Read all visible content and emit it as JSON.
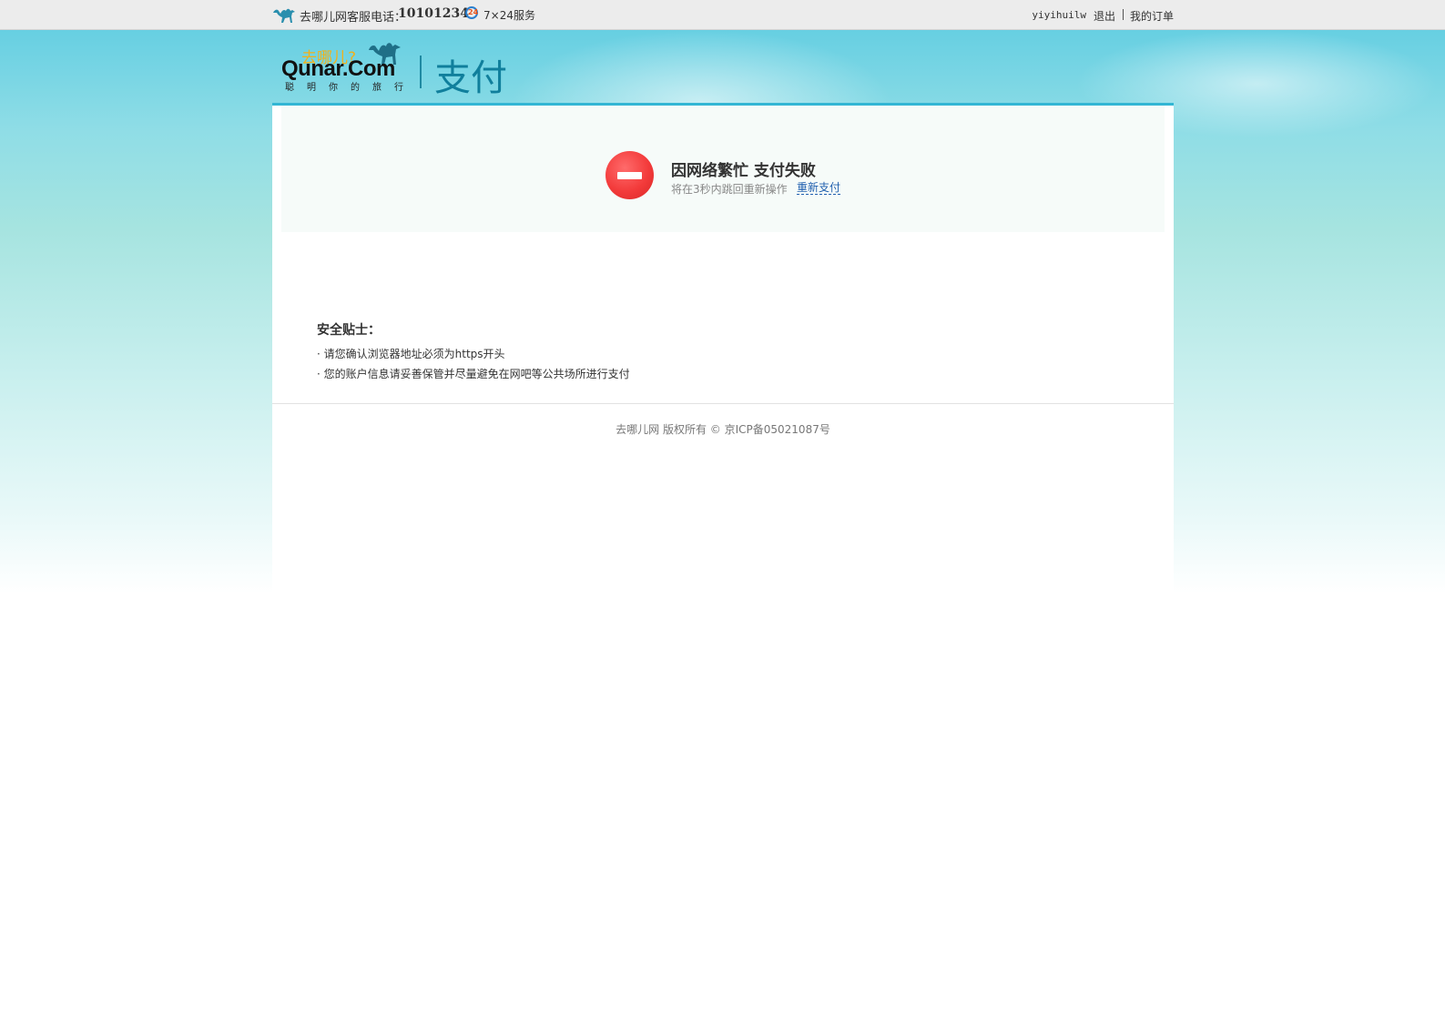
{
  "topbar": {
    "hotline_label": "去哪儿网客服电话：",
    "hotline_number": "10101234",
    "service_badge": "24",
    "service_text": "7×24服务",
    "username": "yiyihuilw",
    "logout_label": "退出",
    "orders_label": "我的订单"
  },
  "header": {
    "logo_slogan": "去哪儿?",
    "logo_wordmark": "Qunar.Com",
    "logo_tagline": "聪明你的旅行",
    "title": "支付"
  },
  "alert": {
    "title": "因网络繁忙  支付失败",
    "subtitle": "将在3秒内跳回重新操作",
    "retry_label": "重新支付",
    "icon": "no-entry-icon",
    "icon_color": "#f33b3b"
  },
  "tips": {
    "title": "安全贴士：",
    "items": [
      "请您确认浏览器地址必须为https开头",
      "您的账户信息请妥善保管并尽量避免在网吧等公共场所进行支付"
    ]
  },
  "footer": {
    "copyright": "去哪儿网 版权所有 © 京ICP备05021087号"
  },
  "colors": {
    "accent": "#33b6d4",
    "header_title": "#107f9c",
    "link": "#1f5fae",
    "logo_yellow": "#f0b11c"
  }
}
